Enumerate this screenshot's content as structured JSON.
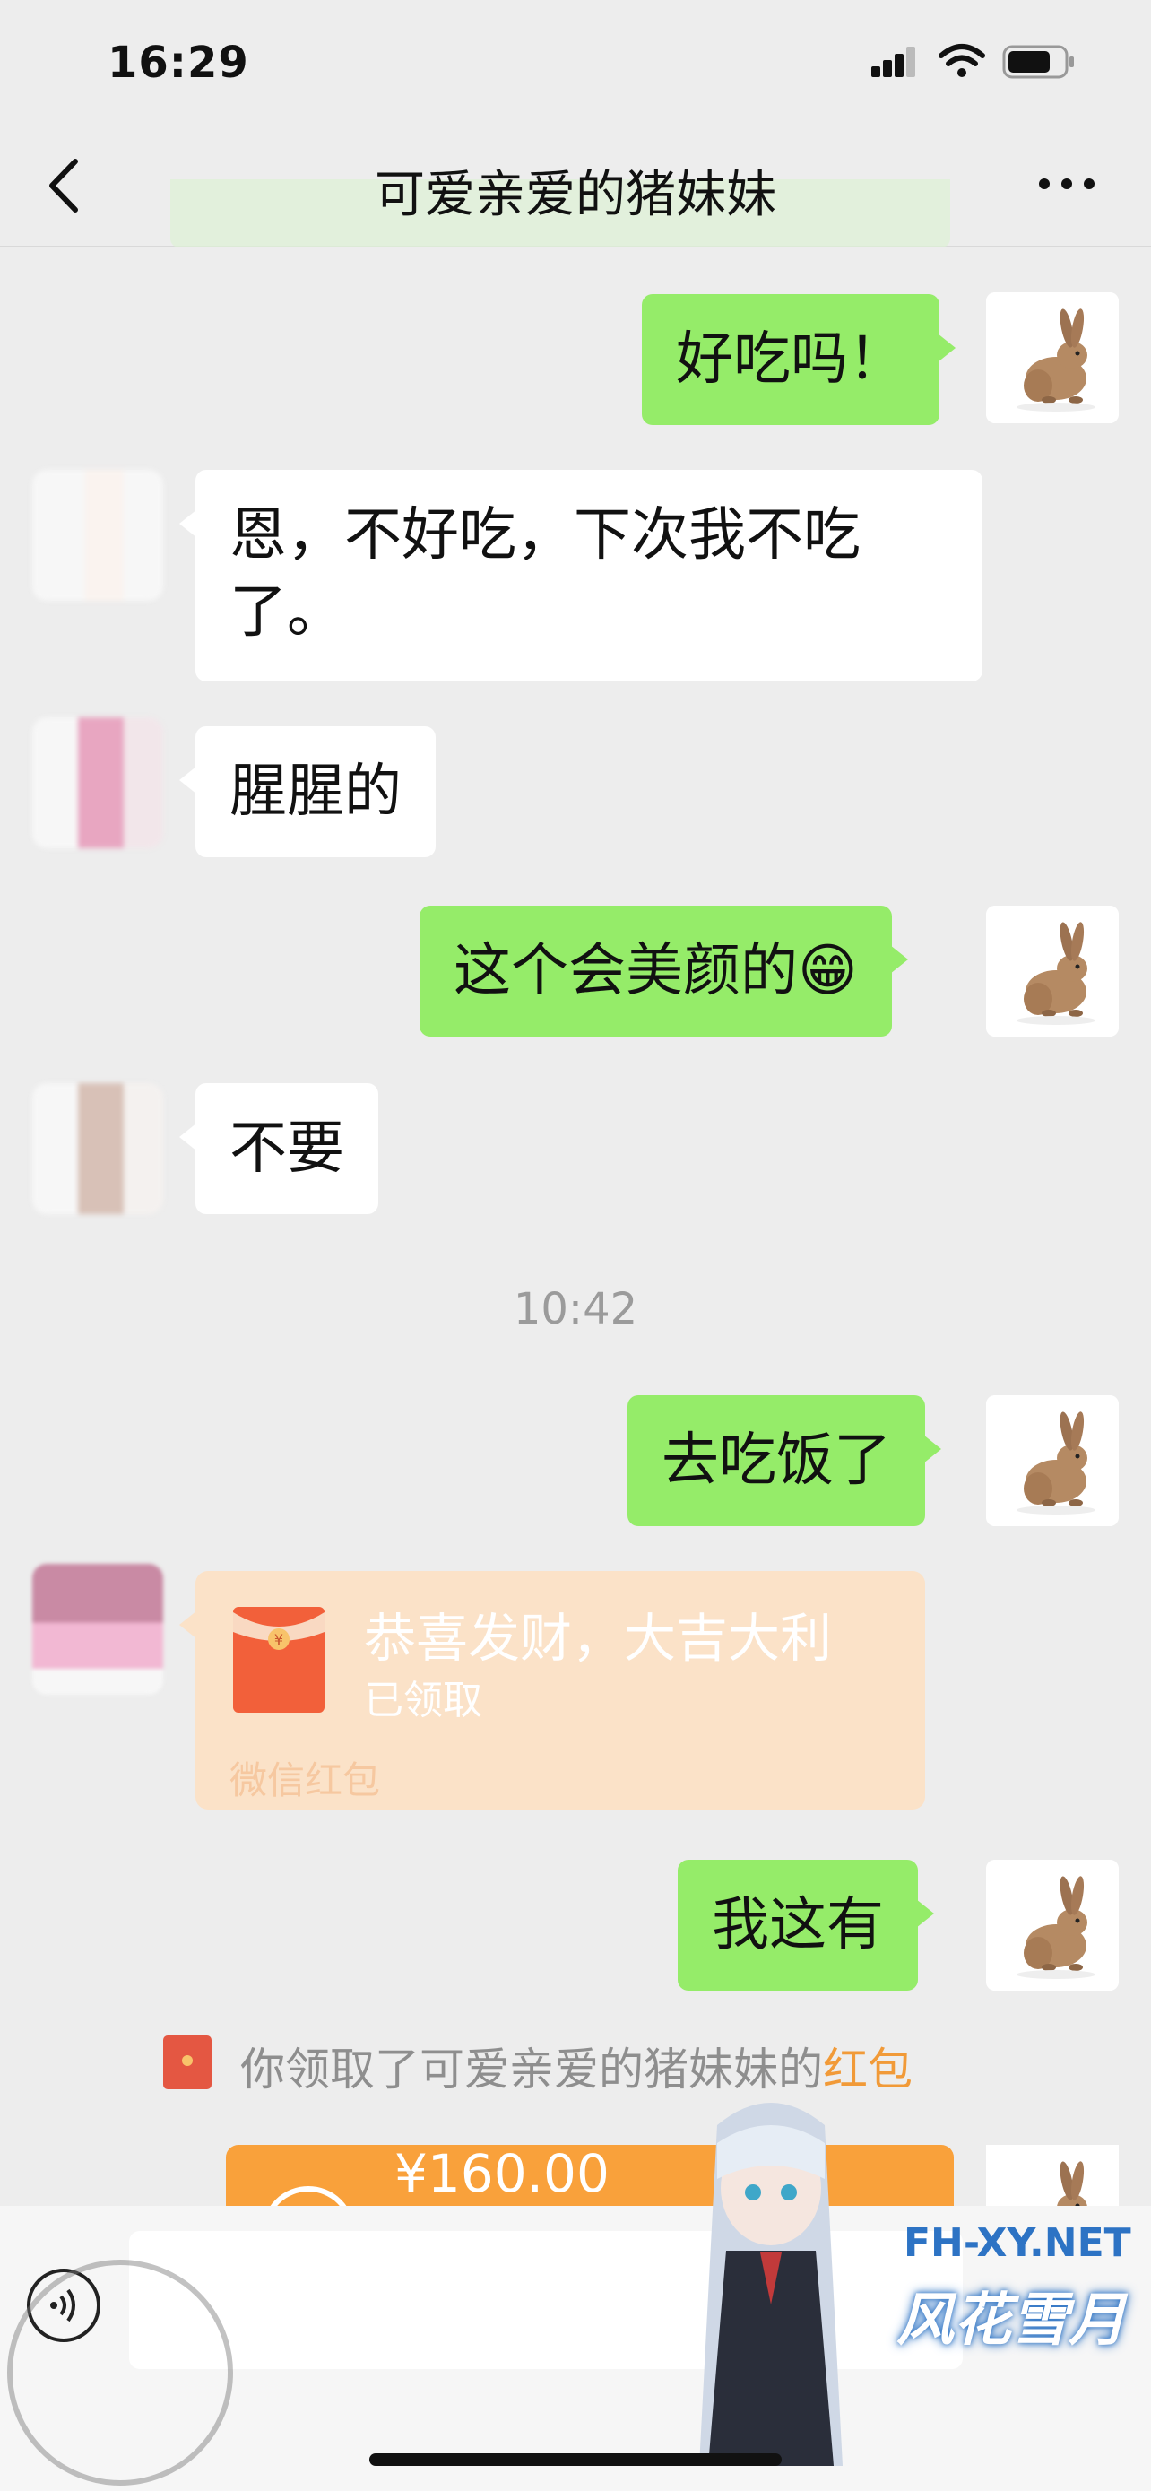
{
  "status_bar": {
    "time": "16:29"
  },
  "nav": {
    "title": "可爱亲爱的猪妹妹"
  },
  "messages": {
    "m1": "好吃吗！",
    "m2_line1": "恩，不好吃，下次我不吃",
    "m2_line2": "了。",
    "m3": "腥腥的",
    "m4": "这个会美颜的😁",
    "m5": "不要",
    "time_separator": "10:42",
    "m6": "去吃饭了",
    "red_packet": {
      "title": "恭喜发财，大吉大利",
      "status": "已领取",
      "footer": "微信红包"
    },
    "m7": "我这有",
    "notice_prefix": "你领取了可爱亲爱的猪妹妹的",
    "notice_link": "红包",
    "transfer_amount": "¥160.00"
  },
  "watermark": {
    "site": "FH-XY.NET",
    "name": "风花雪月"
  },
  "icons": [
    "back-icon",
    "more-icon",
    "signal-icon",
    "wifi-icon",
    "battery-icon",
    "voice-icon",
    "red-packet-icon"
  ],
  "colors": {
    "my_bubble": "#95ec69",
    "their_bubble": "#ffffff",
    "red_packet": "#fbe2c8",
    "transfer": "#f9a13b",
    "link": "#f19a38"
  }
}
